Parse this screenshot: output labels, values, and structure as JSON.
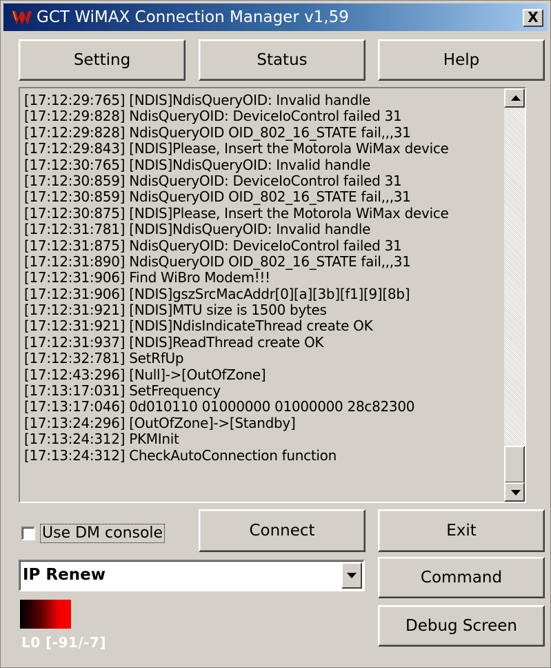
{
  "window": {
    "title": "GCT WiMAX Connection Manager v1,59",
    "close_glyph": "X",
    "icon": "wimax-logo-icon"
  },
  "top_buttons": {
    "setting": "Setting",
    "status": "Status",
    "help": "Help"
  },
  "log": {
    "lines": [
      "[17:12:29:765] [NDIS]NdisQueryOID: Invalid handle",
      "[17:12:29:828] NdisQueryOID: DeviceIoControl failed 31",
      "[17:12:29:828] NdisQueryOID OID_802_16_STATE fail,,,31",
      "[17:12:29:843] [NDIS]Please, Insert the Motorola WiMax device",
      "[17:12:30:765] [NDIS]NdisQueryOID: Invalid handle",
      "[17:12:30:859] NdisQueryOID: DeviceIoControl failed 31",
      "[17:12:30:859] NdisQueryOID OID_802_16_STATE fail,,,31",
      "[17:12:30:875] [NDIS]Please, Insert the Motorola WiMax device",
      "[17:12:31:781] [NDIS]NdisQueryOID: Invalid handle",
      "[17:12:31:875] NdisQueryOID: DeviceIoControl failed 31",
      "[17:12:31:890] NdisQueryOID OID_802_16_STATE fail,,,31",
      "[17:12:31:906] Find WiBro Modem!!!",
      "[17:12:31:906] [NDIS]gszSrcMacAddr[0][a][3b][f1][9][8b]",
      "[17:12:31:921] [NDIS]MTU size is 1500 bytes",
      "[17:12:31:921] [NDIS]NdisIndicateThread create OK",
      "[17:12:31:937] [NDIS]ReadThread create OK",
      "[17:12:32:781] SetRfUp",
      "[17:12:43:296] [Null]->[OutOfZone]",
      "[17:13:17:031] SetFrequency",
      "[17:13:17:046] 0d010110 01000000 01000000 28c82300",
      "[17:13:24:296] [OutOfZone]->[Standby]",
      "[17:13:24:312] PKMInit",
      "[17:13:24:312] CheckAutoConnection function"
    ]
  },
  "controls": {
    "use_dm_console_label": "Use DM console",
    "use_dm_console_checked": false,
    "connect": "Connect",
    "exit": "Exit",
    "command_select_value": "IP Renew",
    "command": "Command",
    "debug_screen": "Debug Screen"
  },
  "signal": {
    "readout": "L0 [-91/-7]",
    "bar_color_start": "#000000",
    "bar_color_end": "#ff0000"
  }
}
